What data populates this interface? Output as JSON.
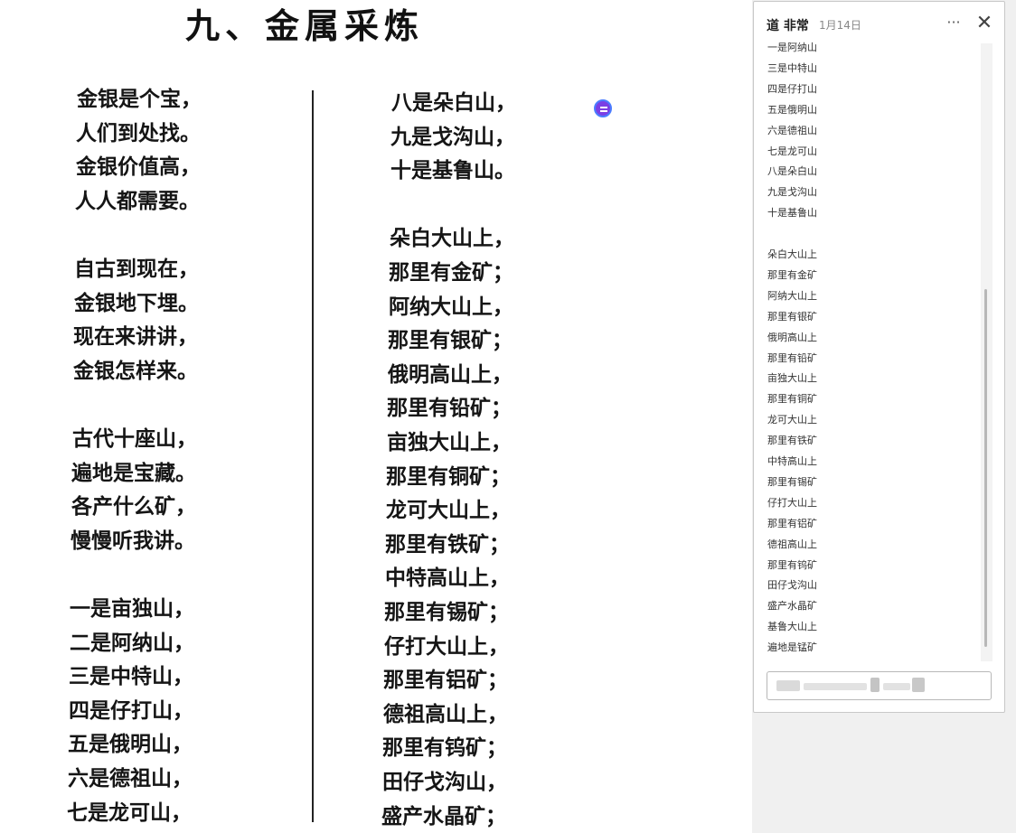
{
  "document": {
    "title": "九、金属采炼",
    "left_column": [
      "金银是个宝，",
      "人们到处找。",
      "金银价值高，",
      "人人都需要。",
      "",
      "自古到现在，",
      "金银地下埋。",
      "现在来讲讲，",
      "金银怎样来。",
      "",
      "古代十座山，",
      "遍地是宝藏。",
      "各产什么矿，",
      "慢慢听我讲。",
      "",
      "一是亩独山，",
      "二是阿纳山，",
      "三是中特山，",
      "四是仔打山，",
      "五是俄明山，",
      "六是德祖山，",
      "七是龙可山，"
    ],
    "right_column": [
      "八是朵白山，",
      "九是戈沟山，",
      "十是基鲁山。",
      "",
      "朵白大山上，",
      "那里有金矿；",
      "阿纳大山上，",
      "那里有银矿；",
      "俄明高山上，",
      "那里有铅矿；",
      "亩独大山上，",
      "那里有铜矿；",
      "龙可大山上，",
      "那里有铁矿；",
      "中特高山上，",
      "那里有锡矿；",
      "仔打大山上，",
      "那里有铝矿；",
      "德祖高山上，",
      "那里有钨矿；",
      "田仔戈沟山，",
      "盛产水晶矿；"
    ]
  },
  "comment_panel": {
    "author": "道 非常",
    "date": "1月14日",
    "more_icon": "more-horizontal-icon",
    "more_label": "···",
    "close_icon": "close-icon",
    "close_label": "✕",
    "lines": [
      "一是阿纳山",
      "三是中特山",
      "四是仔打山",
      "五是俄明山",
      "六是德祖山",
      "七是龙可山",
      "八是朵白山",
      "九是戈沟山",
      "十是基鲁山",
      "",
      "朵白大山上",
      "那里有金矿",
      "阿纳大山上",
      "那里有银矿",
      "俄明高山上",
      "那里有铅矿",
      "亩独大山上",
      "那里有铜矿",
      "龙可大山上",
      "那里有铁矿",
      "中特高山上",
      "那里有锡矿",
      "仔打大山上",
      "那里有铝矿",
      "德祖高山上",
      "那里有钨矿",
      "田仔戈沟山",
      "盛产水晶矿",
      "基鲁大山上",
      "遍地是锰矿"
    ]
  },
  "colors": {
    "marker": "#7b3fe4",
    "marker_ring": "#4a7dff"
  }
}
